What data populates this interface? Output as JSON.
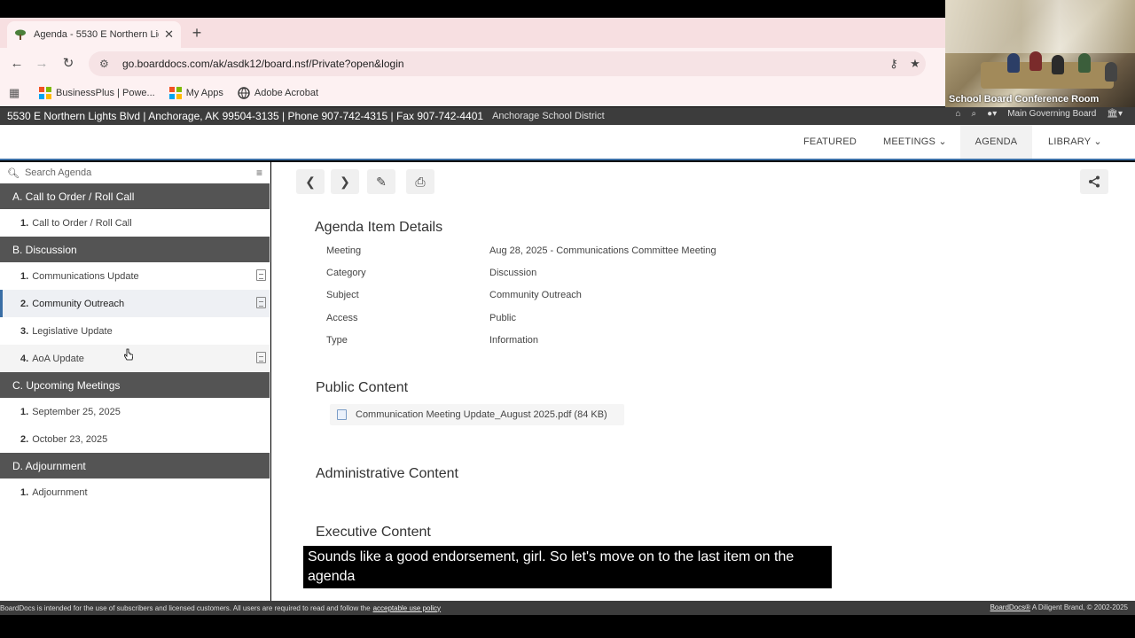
{
  "browser": {
    "tab_title": "Agenda - 5530 E Northern Ligh",
    "url": "go.boarddocs.com/ak/asdk12/board.nsf/Private?open&login",
    "bookmarks": [
      {
        "label": "BusinessPlus | Powe...",
        "icon": "windows-logo-icon"
      },
      {
        "label": "My Apps",
        "icon": "windows-logo-icon"
      },
      {
        "label": "Adobe Acrobat",
        "icon": "globe-icon"
      }
    ]
  },
  "webcam": {
    "label": "School Board Conference Room"
  },
  "site": {
    "address": "5530 E Northern Lights Blvd | Anchorage, AK 99504-3135 | Phone 907-742-4315 | Fax 907-742-4401",
    "district": "Anchorage School District",
    "board": "Main Governing Board"
  },
  "menu": {
    "featured": "FEATURED",
    "meetings": "MEETINGS",
    "agenda": "AGENDA",
    "library": "LIBRARY"
  },
  "sidebar": {
    "search_placeholder": "Search Agenda",
    "sections": [
      {
        "label": "A. Call to Order / Roll Call",
        "items": [
          {
            "num": "1.",
            "label": "Call to Order / Roll Call"
          }
        ]
      },
      {
        "label": "B. Discussion",
        "items": [
          {
            "num": "1.",
            "label": "Communications Update"
          },
          {
            "num": "2.",
            "label": "Community Outreach"
          },
          {
            "num": "3.",
            "label": "Legislative Update"
          },
          {
            "num": "4.",
            "label": "AoA Update"
          }
        ]
      },
      {
        "label": "C. Upcoming Meetings",
        "items": [
          {
            "num": "1.",
            "label": "September 25, 2025"
          },
          {
            "num": "2.",
            "label": "October 23, 2025"
          }
        ]
      },
      {
        "label": "D. Adjournment",
        "items": [
          {
            "num": "1.",
            "label": "Adjournment"
          }
        ]
      }
    ]
  },
  "main": {
    "title": "Agenda Item Details",
    "details": [
      {
        "label": "Meeting",
        "value": "Aug 28, 2025 - Communications Committee Meeting"
      },
      {
        "label": "Category",
        "value": "Discussion"
      },
      {
        "label": "Subject",
        "value": "Community Outreach"
      },
      {
        "label": "Access",
        "value": "Public"
      },
      {
        "label": "Type",
        "value": "Information"
      }
    ],
    "public_content": "Public Content",
    "file": "Communication Meeting Update_August 2025.pdf (84 KB)",
    "administrative_content": "Administrative Content",
    "executive_content": "Executive Content"
  },
  "footer": {
    "text": "BoardDocs is intended for the use of subscribers and licensed customers. All users are required to read and follow the",
    "link": "acceptable use policy",
    "right_link": "BoardDocs®",
    "right_text": "A Diligent Brand, © 2002-2025"
  },
  "caption": "Sounds like a good endorsement, girl. So let's move on to the last item on the agenda"
}
